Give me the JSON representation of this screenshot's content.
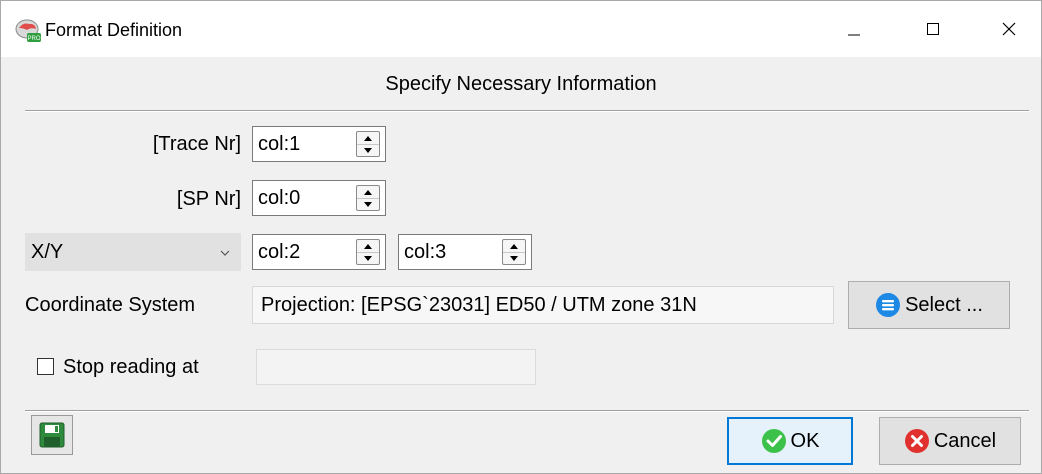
{
  "window": {
    "title": "Format Definition",
    "app_icon": "pro-app-icon",
    "controls": [
      "minimize-icon",
      "maximize-icon",
      "close-icon"
    ]
  },
  "header": {
    "title": "Specify Necessary Information"
  },
  "fields": {
    "trace_nr": {
      "label": "[Trace Nr]",
      "value": "col:1"
    },
    "sp_nr": {
      "label": "[SP Nr]",
      "value": "col:0"
    },
    "xy": {
      "selected": "X/Y",
      "x_value": "col:2",
      "y_value": "col:3"
    },
    "coordinate_system": {
      "label": "Coordinate System",
      "value": "Projection: [EPSG`23031] ED50 / UTM zone 31N",
      "select_label": "Select ..."
    },
    "stop_reading": {
      "label": "Stop reading at",
      "checked": false,
      "value": ""
    }
  },
  "footer": {
    "save_icon": "floppy-disk-icon",
    "ok_label": "OK",
    "cancel_label": "Cancel"
  },
  "colors": {
    "ok_border": "#0078d7",
    "ok_icon": "#3cc24a",
    "cancel_icon": "#e0312e",
    "select_icon": "#1e88e5",
    "save_icon": "#2e8b3e"
  }
}
